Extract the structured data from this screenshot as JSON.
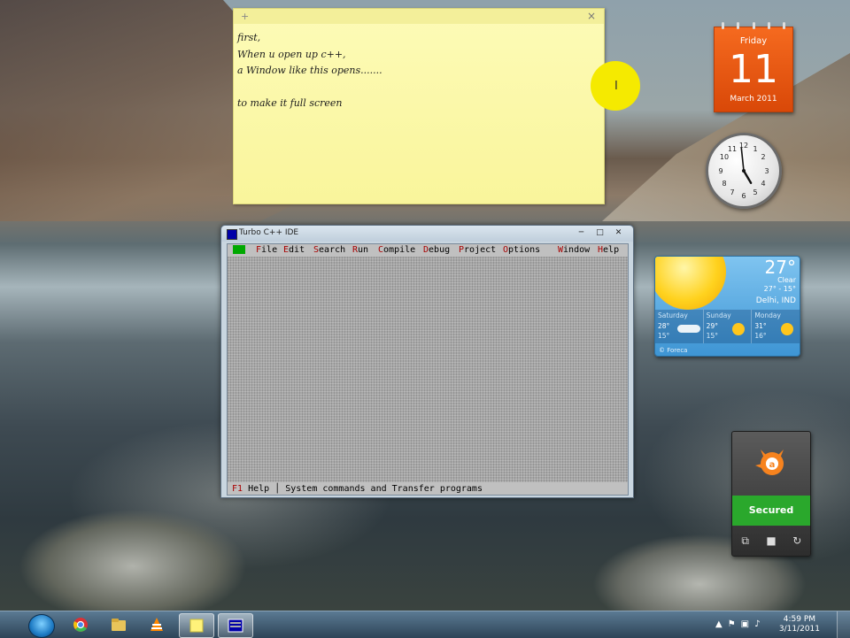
{
  "sticky_note": {
    "add_icon": "+",
    "close_icon": "×",
    "lines": [
      "first,",
      "When u open up c++,",
      "a Window like this opens.......",
      "",
      "to make it full screen"
    ],
    "cursor_glyph": "I"
  },
  "turbo_window": {
    "title": "Turbo C++ IDE",
    "controls": {
      "minimize": "─",
      "maximize": "□",
      "close": "✕"
    },
    "menu": {
      "system": "≡",
      "items": [
        {
          "hot": "F",
          "rest": "ile"
        },
        {
          "hot": "E",
          "rest": "dit"
        },
        {
          "hot": "S",
          "rest": "earch"
        },
        {
          "hot": "R",
          "rest": "un"
        },
        {
          "hot": "C",
          "rest": "ompile"
        },
        {
          "hot": "D",
          "rest": "ebug"
        },
        {
          "hot": "P",
          "rest": "roject"
        },
        {
          "hot": "O",
          "rest": "ptions"
        },
        {
          "hot": "W",
          "rest": "indow"
        },
        {
          "hot": "H",
          "rest": "elp"
        }
      ]
    },
    "status": {
      "key": "F1",
      "key_label": " Help",
      "separator": " │ ",
      "message": "System commands and Transfer programs"
    }
  },
  "calendar": {
    "weekday": "Friday",
    "day": "11",
    "month_year": "March 2011"
  },
  "clock": {
    "hour": 4,
    "minute": 59
  },
  "weather": {
    "temperature": "27°",
    "condition": "Clear",
    "range": "27° - 15°",
    "location": "Delhi, IND",
    "forecast": [
      {
        "day": "Saturday",
        "high": "28°",
        "low": "15°",
        "icon": "cloud-icon"
      },
      {
        "day": "Sunday",
        "high": "29°",
        "low": "15°",
        "icon": "sun-icon"
      },
      {
        "day": "Monday",
        "high": "31°",
        "low": "16°",
        "icon": "sun-icon"
      }
    ],
    "credit": "© Foreca"
  },
  "avast": {
    "status": "Secured",
    "status_color": "#2aa82c"
  },
  "taskbar": {
    "items": [
      "start-orb",
      "chrome-icon",
      "explorer-icon",
      "vlc-icon",
      "sticky-notes-icon",
      "turbo-cpp-icon"
    ],
    "time": "4:59 PM",
    "date": "3/11/2011"
  }
}
